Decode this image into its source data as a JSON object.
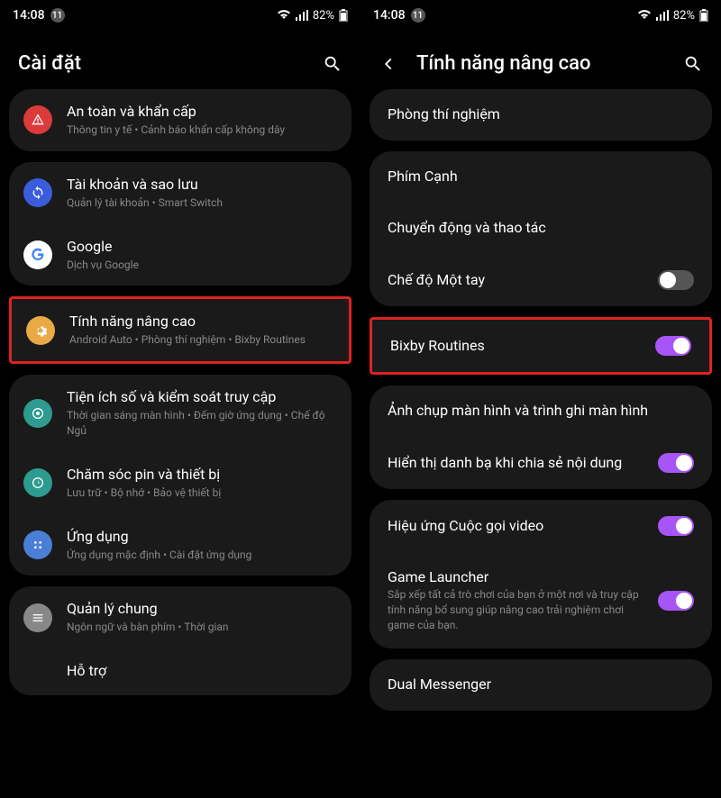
{
  "status": {
    "time": "14:08",
    "notif": "11",
    "battery": "82%"
  },
  "left": {
    "title": "Cài đặt",
    "items": [
      {
        "title": "An toàn và khẩn cấp",
        "subtitle": "Thông tin y tế • Cảnh báo khẩn cấp không dây"
      },
      {
        "title": "Tài khoản và sao lưu",
        "subtitle": "Quản lý tài khoản • Smart Switch"
      },
      {
        "title": "Google",
        "subtitle": "Dịch vụ Google"
      },
      {
        "title": "Tính năng nâng cao",
        "subtitle": "Android Auto • Phòng thí nghiệm • Bixby Routines"
      },
      {
        "title": "Tiện ích số và kiểm soát truy cập",
        "subtitle": "Thời gian sáng màn hình • Đếm giờ ứng dụng • Chế độ Ngủ"
      },
      {
        "title": "Chăm sóc pin và thiết bị",
        "subtitle": "Lưu trữ • Bộ nhớ • Bảo vệ thiết bị"
      },
      {
        "title": "Ứng dụng",
        "subtitle": "Ứng dụng mặc định • Cài đặt ứng dụng"
      },
      {
        "title": "Quản lý chung",
        "subtitle": "Ngôn ngữ và bàn phím • Thời gian"
      },
      {
        "title": "Hỗ trợ",
        "subtitle": ""
      }
    ]
  },
  "right": {
    "title": "Tính năng nâng cao",
    "items": [
      {
        "title": "Phòng thí nghiệm",
        "toggle": null
      },
      {
        "title": "Phím Cạnh",
        "toggle": null
      },
      {
        "title": "Chuyển động và thao tác",
        "toggle": null
      },
      {
        "title": "Chế độ Một tay",
        "toggle": "off"
      },
      {
        "title": "Bixby Routines",
        "toggle": "on"
      },
      {
        "title": "Ảnh chụp màn hình và trình ghi màn hình",
        "toggle": null
      },
      {
        "title": "Hiển thị danh bạ khi chia sẻ nội dung",
        "toggle": "on"
      },
      {
        "title": "Hiệu ứng Cuộc gọi video",
        "toggle": "on"
      },
      {
        "title": "Game Launcher",
        "subtitle": "Sắp xếp tất cả trò chơi của bạn ở một nơi và truy cập tính năng bổ sung giúp nâng cao trải nghiệm chơi game của bạn.",
        "toggle": "on"
      },
      {
        "title": "Dual Messenger",
        "toggle": null
      }
    ]
  }
}
